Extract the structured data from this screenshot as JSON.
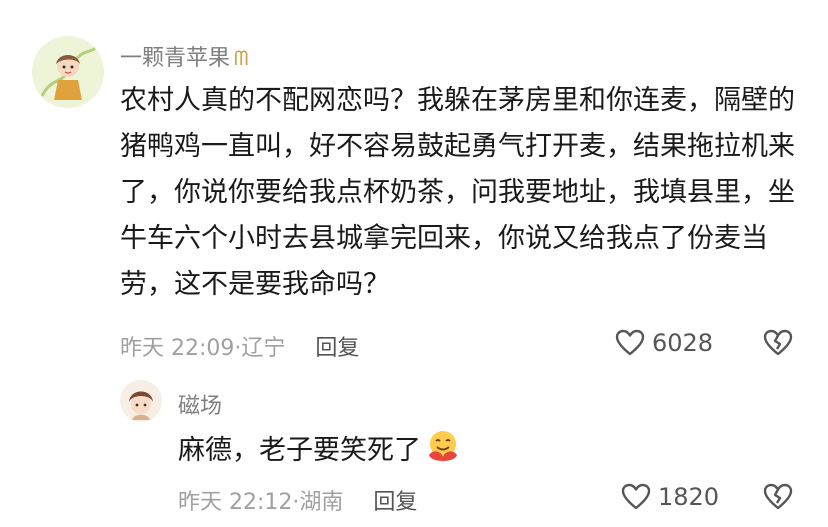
{
  "comment": {
    "username": "一颗青苹果",
    "vip_badge": "ᗰ",
    "text": "农村人真的不配网恋吗？我躲在茅房里和你连麦，隔壁的猪鸭鸡一直叫，好不容易鼓起勇气打开麦，结果拖拉机来了，你说你要给我点杯奶茶，问我要地址，我填县里，坐牛车六个小时去县城拿完回来，你说又给我点了份麦当劳，这不是要我命吗？",
    "time": "昨天 22:09",
    "location": "辽宁",
    "reply_label": "回复",
    "likes": "6028",
    "icons": {
      "like": "heart-outline-icon",
      "dislike": "broken-heart-icon",
      "avatar": "avatar-illustration"
    }
  },
  "reply": {
    "username": "磁场",
    "text": "麻德，老子要笑死了",
    "emoji": "hug-emoji",
    "time": "昨天 22:12",
    "location": "湖南",
    "reply_label": "回复",
    "likes": "1820",
    "icons": {
      "like": "heart-outline-icon",
      "dislike": "broken-heart-icon",
      "avatar": "avatar-illustration"
    }
  },
  "colors": {
    "text": "#1a1a1a",
    "meta": "#a0a0a0",
    "username": "#7f7f7f",
    "icon": "#555555"
  }
}
